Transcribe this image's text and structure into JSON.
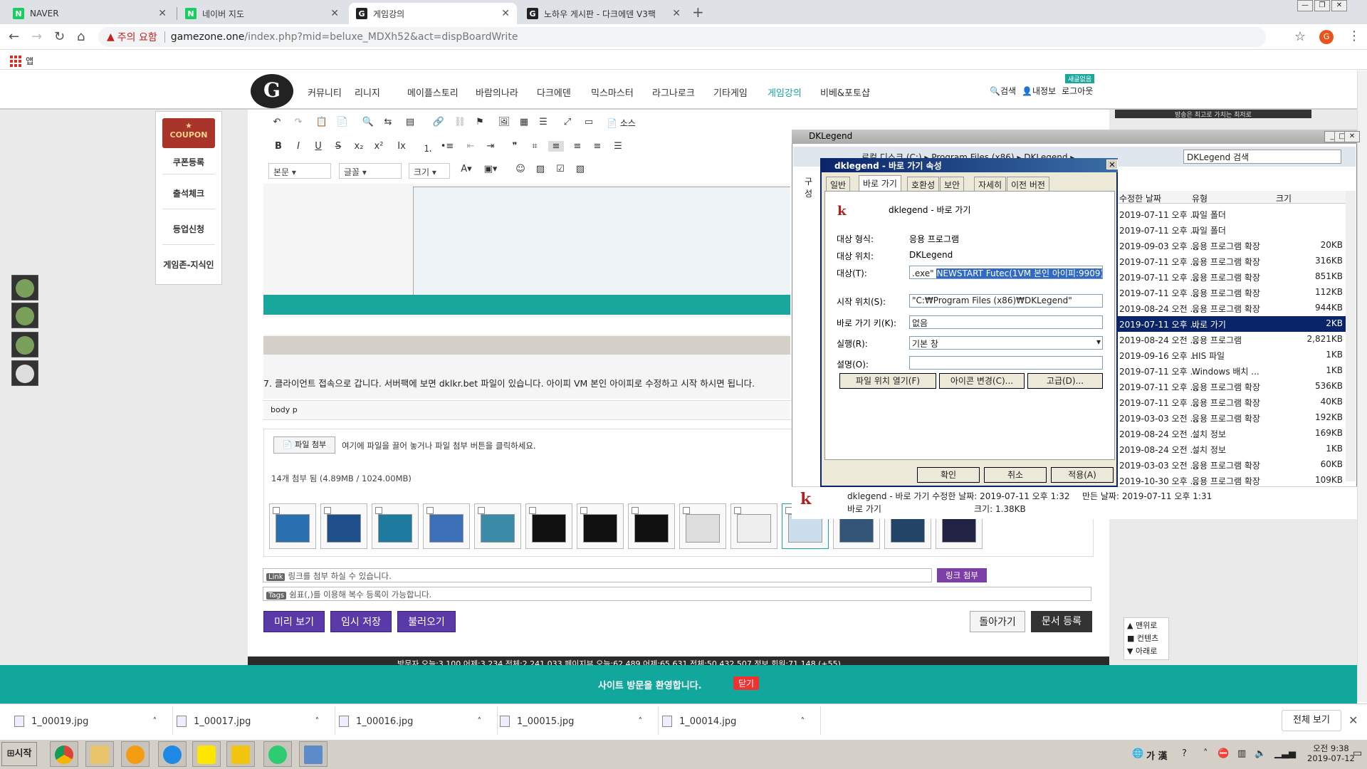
{
  "browser": {
    "tabs": [
      {
        "label": "NAVER",
        "favicon": "N",
        "favicon_color": "#19ce60"
      },
      {
        "label": "네이버 지도",
        "favicon": "N",
        "favicon_color": "#19ce60"
      },
      {
        "label": "게임강의",
        "favicon": "G",
        "favicon_color": "#222222"
      },
      {
        "label": "노하우 게시판 - 다크에덴 V3팩",
        "favicon": "G",
        "favicon_color": "#222222"
      }
    ],
    "security_label": "주의 요함",
    "url_host": "gamezone.one",
    "url_path": "/index.php?mid=beluxe_MDXh52&act=dispBoardWrite",
    "profile_initial": "G",
    "bookmarks_apps": "앱"
  },
  "site": {
    "nav": [
      "커뮤니티",
      "리니지",
      "메이플스토리",
      "바람의나라",
      "다크에덴",
      "믹스마스터",
      "라그나로크",
      "기타게임",
      "게임강의",
      "비베&포토샵"
    ],
    "active_nav": "게임강의",
    "search": "검색",
    "myinfo": "내정보",
    "logout": "로그아웃",
    "new_badge": "새글없음",
    "ad_text": "방송은 최고로 가치는 최저로",
    "left": {
      "coupon": "COUPON",
      "items": [
        "쿠폰등록",
        "출석체크",
        "등업신청",
        "게임존-지식인"
      ]
    },
    "editor": {
      "source_label": "소스",
      "style_dd": "본문",
      "font_dd": "글꼴",
      "size_dd": "크기",
      "body_text": "7. 클라이언트 접속으로 갑니다. 서버팩에 보면 dklkr.bet 파일이 있습니다. 아이피 VM 본인 아이피로 수정하고 시작 하시면 됩니다.",
      "path": [
        "body",
        "p"
      ]
    },
    "attach": {
      "button": "파일 첨부",
      "hint": "여기에 파일을 끌어 놓거나 파일 첨부 버튼을 클릭하세요.",
      "count": "14개 첨부 됨 (4.89MB / 1024.00MB)"
    },
    "link": {
      "label": "Link",
      "placeholder": "링크를 첨부 하실 수 있습니다.",
      "button": "링크 첨부"
    },
    "tags": {
      "label": "Tags",
      "placeholder": "쉼표(,)를 이용해 복수 등록이 가능합니다."
    },
    "buttons": {
      "preview": "미리 보기",
      "temp_save": "임시 저장",
      "load": "불러오기",
      "back": "돌아가기",
      "submit": "문서 등록"
    },
    "stats": "방문자  오늘:3,100  어제:3,234  전체:2,241,033     페이지뷰  오늘:62,489  어제:65,631  전체:50,432,507     정보  회원:71,148 (+55)",
    "welcome": "사이트 방문을 환영합니다.",
    "welcome_close": "닫기",
    "side_links": [
      "맨위로",
      "컨텐츠",
      "아래로"
    ]
  },
  "explorer": {
    "title": "DKLegend",
    "address": "로컬 디스크 (C:) ▸ Program Files (x86) ▸ DKLegend ▸",
    "search_placeholder": "DKLegend 검색",
    "col_date": "수정한 날짜",
    "col_type": "유형",
    "col_size": "크기",
    "rows": [
      {
        "date": "2019-07-11 오후 ...",
        "type": "파일 폴더",
        "size": ""
      },
      {
        "date": "2019-07-11 오후 ...",
        "type": "파일 폴더",
        "size": ""
      },
      {
        "date": "2019-09-03 오후 ...",
        "type": "응용 프로그램 확장",
        "size": "20KB"
      },
      {
        "date": "2019-07-11 오후 ...",
        "type": "응용 프로그램 확장",
        "size": "316KB"
      },
      {
        "date": "2019-07-11 오후 ...",
        "type": "응용 프로그램 확장",
        "size": "851KB"
      },
      {
        "date": "2019-07-11 오후 ...",
        "type": "응용 프로그램 확장",
        "size": "112KB"
      },
      {
        "date": "2019-08-24 오전 ...",
        "type": "응용 프로그램 확장",
        "size": "944KB"
      },
      {
        "date": "2019-07-11 오후 ...",
        "type": "바로 가기",
        "size": "2KB",
        "selected": true
      },
      {
        "date": "2019-08-24 오전 ...",
        "type": "응용 프로그램",
        "size": "2,821KB"
      },
      {
        "date": "2019-09-16 오후 ...",
        "type": "HIS 파일",
        "size": "1KB"
      },
      {
        "date": "2019-07-11 오후 ...",
        "type": "Windows 배치 ...",
        "size": "1KB"
      },
      {
        "date": "2019-07-11 오후 ...",
        "type": "응용 프로그램 확장",
        "size": "536KB"
      },
      {
        "date": "2019-07-11 오후 ...",
        "type": "응용 프로그램 확장",
        "size": "40KB"
      },
      {
        "date": "2019-03-03 오전 ...",
        "type": "응용 프로그램 확장",
        "size": "192KB"
      },
      {
        "date": "2019-08-24 오전 ...",
        "type": "설치 정보",
        "size": "169KB"
      },
      {
        "date": "2019-08-24 오전 ...",
        "type": "설치 정보",
        "size": "1KB"
      },
      {
        "date": "2019-03-03 오전 ...",
        "type": "응용 프로그램 확장",
        "size": "60KB"
      },
      {
        "date": "2019-10-30 오후 ...",
        "type": "응용 프로그램 확장",
        "size": "109KB"
      }
    ],
    "detail_name": "dklegend - 바로 가기  수정한 날짜: 2019-07-11 오후 1:32",
    "detail_created": "만든 날짜: 2019-07-11 오후 1:31",
    "detail_type": "바로 가기",
    "detail_size": "크기: 1.38KB",
    "org_label": "구성"
  },
  "dialog": {
    "title": "dklegend - 바로 가기 속성",
    "tabs": [
      "일반",
      "바로 가기",
      "호환성",
      "보안",
      "자세히",
      "이전 버전"
    ],
    "name": "dklegend - 바로 가기",
    "type_label": "대상 형식:",
    "type_val": "응용 프로그램",
    "loc_label": "대상 위치:",
    "loc_val": "DKLegend",
    "target_label": "대상(T):",
    "target_pre": ".exe\"",
    "target_sel": "NEWSTART Futec(1VM 본인 아이피:9909)",
    "start_label": "시작 위치(S):",
    "start_val": "\"C:₩Program Files (x86)₩DKLegend\"",
    "key_label": "바로 가기 키(K):",
    "key_val": "없음",
    "run_label": "실행(R):",
    "run_val": "기본 창",
    "comment_label": "설명(O):",
    "btn_open": "파일 위치 열기(F)",
    "btn_icon": "아이콘 변경(C)...",
    "btn_adv": "고급(D)...",
    "ok": "확인",
    "cancel": "취소",
    "apply": "적용(A)"
  },
  "downloads": [
    "1_00019.jpg",
    "1_00017.jpg",
    "1_00016.jpg",
    "1_00015.jpg",
    "1_00014.jpg"
  ],
  "downloads_showall": "전체 보기",
  "taskbar": {
    "start": "시작",
    "ime": "가 漢",
    "time": "오전 9:38",
    "date": "2019-07-12"
  }
}
